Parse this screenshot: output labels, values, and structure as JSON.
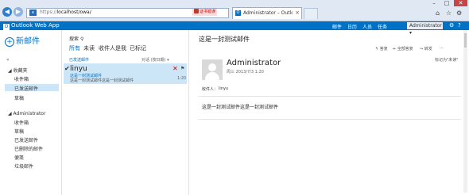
{
  "browser": {
    "url_prefix": "https://",
    "url_host": "localhost/owa/",
    "cert_error": "证书错误",
    "tab_title": "Administrator – Outlook ...",
    "tab_close": "×"
  },
  "owa": {
    "app_name": "Outlook Web App",
    "nav": [
      "邮件",
      "日历",
      "人员",
      "任务"
    ],
    "user": "Administrator ▾",
    "accent": "#0072c6"
  },
  "left_pane": {
    "new_mail": "新邮件",
    "favorites_header": "收藏夹",
    "favorites": [
      "收件箱",
      "已发送邮件",
      "草稿"
    ],
    "account_header": "Administrator",
    "folders": [
      "收件箱",
      "草稿",
      "已发送邮件",
      "已删除的邮件",
      "便笺",
      "垃圾邮件"
    ]
  },
  "message_list": {
    "search_label": "搜索",
    "filters": [
      "所有",
      "未读",
      "收件人是我",
      "已标记"
    ],
    "folder_title": "已发送邮件",
    "sort_label": "对话 (按日期) ▾",
    "messages": [
      {
        "to": "linyu",
        "subject": "这是一封测试邮件",
        "preview": "这是一封测试邮件这是一封测试邮件",
        "time": "1:20"
      }
    ]
  },
  "reading_pane": {
    "subject": "这是一封测试邮件",
    "actions": [
      "答复",
      "全部答复",
      "转发"
    ],
    "flag_note": "标记为\"未读\"",
    "sender": "Administrator",
    "date": "周三 2013/7/3 1:20",
    "to_label": "收件人：",
    "to": "linyu",
    "body": "这是一封测试邮件这是一封测试邮件"
  }
}
